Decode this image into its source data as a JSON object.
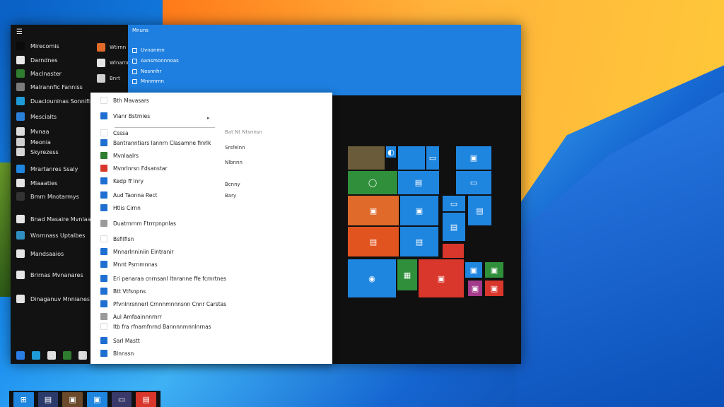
{
  "rail": {
    "top_icon": "hamburger-icon",
    "items": [
      {
        "label": "Mirecomis",
        "icon_color": "#0b0b0b"
      },
      {
        "label": "Darndnes",
        "icon_color": "#e9e9e9"
      },
      {
        "label": "Maclnaster",
        "icon_color": "#2f7d2f"
      },
      {
        "label": "Malrannfic Fanniss",
        "icon_color": "#7b7b7b"
      },
      {
        "label": "Duaciouninas Sonnifinas",
        "icon_color": "#1e9bd7"
      },
      {
        "label": "Mescialts",
        "icon_color": "#2a7fd9"
      },
      {
        "label": "Mvnaa",
        "icon_color": "#dcdcdc"
      },
      {
        "label": "Meonia",
        "icon_color": "#cfcfcf"
      },
      {
        "label": "Skyrezess",
        "icon_color": "#d5d5d5"
      },
      {
        "label": "Mrartanres Ssaly",
        "icon_color": "#1f86e0"
      },
      {
        "label": "Mlaaaties",
        "icon_color": "#e5e5e5"
      },
      {
        "label": "Bmrn Mnotarmys",
        "icon_color": "#333333"
      },
      {
        "label": "Bnad Masaire Mvnlaar Sermmtunns",
        "icon_color": "#e6e6e6"
      },
      {
        "label": "Wnrnnass Uptalbes",
        "icon_color": "#2f8fc0"
      },
      {
        "label": "Mandsaaios",
        "icon_color": "#e5e5e5"
      },
      {
        "label": "Brirnas Mvnanares",
        "icon_color": "#e5e5e5"
      },
      {
        "label": "Dinaganuv Mnnianes",
        "icon_color": "#e5e5e5"
      }
    ],
    "bottom_icons": [
      {
        "name": "user-icon",
        "color": "#2b7de6"
      },
      {
        "name": "documents-icon",
        "color": "#1e9bd7"
      },
      {
        "name": "pictures-icon",
        "color": "#e0e0e0"
      },
      {
        "name": "settings-icon",
        "color": "#2f7d2f"
      },
      {
        "name": "power-icon",
        "color": "#e0e0e0"
      }
    ]
  },
  "mid": {
    "items": [
      {
        "label": "Wtirnn",
        "icon_color": "#e06a2a"
      },
      {
        "label": "Wlnarnn",
        "icon_color": "#e5e5e5"
      },
      {
        "label": "Bnrt",
        "icon_color": "#cfcfcf"
      }
    ]
  },
  "blue_panel": {
    "title": "Mnuns",
    "items": [
      "Uvnanmn",
      "Aansmonnnoas",
      "Nosnnhr",
      "Mnnmmn"
    ]
  },
  "popup": {
    "rows": [
      {
        "label": "Bth Mavasars",
        "icon_color": "#ffffff"
      },
      {
        "label": "Vianr Bstrnies",
        "icon_color": "#1e6fd1"
      },
      {
        "label": "Csssa",
        "icon_color": "#ffffff"
      },
      {
        "label": "Bantranntiars lannrn Clasamne finrlk",
        "icon_color": "#1e6fd1"
      },
      {
        "label": "Mvnlaalrs",
        "icon_color": "#2f7d2f"
      },
      {
        "label": "Mvnrlnrsn Fdsanstar",
        "icon_color": "#d9362c"
      },
      {
        "label": "Kedp ff lnry",
        "icon_color": "#1e6fd1"
      },
      {
        "label": "Aud Taonna Rect",
        "icon_color": "#1e6fd1"
      },
      {
        "label": "Htlis Cirnn",
        "icon_color": "#1e6fd1"
      },
      {
        "label": "Duatrnrnm Ftrrrpnpnlas",
        "icon_color": "#9a9a9a"
      },
      {
        "label": "Bsfilfisn",
        "icon_color": "#ffffff"
      },
      {
        "label": "Mnnarlnniniin Eintranir",
        "icon_color": "#1e6fd1"
      },
      {
        "label": "Mnnt Psrnmnnas",
        "icon_color": "#1e6fd1"
      },
      {
        "label": "Eri penaraa cnrnsanl Itnranne ffe fcrnrtnes",
        "icon_color": "#1e6fd1"
      },
      {
        "label": "Btt Vtfsnpns",
        "icon_color": "#1e6fd1"
      },
      {
        "label": "Pfvnlnrsnnerl Crnnnmnnnsnn Cnnr Carstas",
        "icon_color": "#1e6fd1"
      },
      {
        "label": "Aul Amfaainnnrnrr",
        "icon_color": "#9a9a9a"
      },
      {
        "label": "Itb fra rfnarnfnrnd Bannnnmnnlnrnas",
        "icon_color": "#ffffff"
      },
      {
        "label": "Sarl Mastt",
        "icon_color": "#1e6fd1"
      },
      {
        "label": "Blnnssn",
        "icon_color": "#1e6fd1"
      }
    ],
    "right_labels": [
      {
        "text": "Bat Nt Ntsnnsn",
        "muted": true
      },
      {
        "text": "Srsfelnn",
        "muted": false
      },
      {
        "text": "Nlbnnn",
        "muted": false
      },
      {
        "text": "Bcnny",
        "muted": false
      },
      {
        "text": "Bary",
        "muted": false
      }
    ],
    "caret": "▸"
  },
  "tiles": [
    {
      "name": "photo-tile",
      "color": "#6a5b3a",
      "glyph": ""
    },
    {
      "name": "edge-tile",
      "color": "#1f86e0",
      "glyph": "◐"
    },
    {
      "name": "office-tile",
      "color": "#1f86e0",
      "glyph": ""
    },
    {
      "name": "mail-tile",
      "color": "#1f86e0",
      "glyph": "▭"
    },
    {
      "name": "store-tile",
      "color": "#1f86e0",
      "glyph": "▣"
    },
    {
      "name": "news-tile",
      "color": "#1f86e0",
      "glyph": "▤"
    },
    {
      "name": "maps-tile",
      "color": "#2f8f3a",
      "glyph": "◯"
    },
    {
      "name": "weather-tile",
      "color": "#1f86e0",
      "glyph": "▭"
    },
    {
      "name": "photos-tile",
      "color": "#e06a2a",
      "glyph": "▣"
    },
    {
      "name": "people-tile",
      "color": "#1f86e0",
      "glyph": "▣"
    },
    {
      "name": "calendar-tile",
      "color": "#1f86e0",
      "glyph": "▭"
    },
    {
      "name": "money-tile",
      "color": "#1f86e0",
      "glyph": "▤"
    },
    {
      "name": "calculator-tile",
      "color": "#1f86e0",
      "glyph": "▤"
    },
    {
      "name": "powerpoint-tile",
      "color": "#e2541f",
      "glyph": "▤"
    },
    {
      "name": "word-tile",
      "color": "#1f86e0",
      "glyph": "▤"
    },
    {
      "name": "excel-tile",
      "color": "#2f8f3a",
      "glyph": "▦"
    },
    {
      "name": "skype-tile",
      "color": "#1f86e0",
      "glyph": "◉"
    },
    {
      "name": "flipboard-tile",
      "color": "#d9362c",
      "glyph": "▣"
    },
    {
      "name": "xbox-tile",
      "color": "#2f8f3a",
      "glyph": "▣"
    },
    {
      "name": "groove-tile",
      "color": "#a33a8a",
      "glyph": "▣"
    },
    {
      "name": "onenote-tile",
      "color": "#d9362c",
      "glyph": "▣"
    },
    {
      "name": "camera-tile",
      "color": "#1f86e0",
      "glyph": "▣"
    },
    {
      "name": "red-tile",
      "color": "#d9362c",
      "glyph": ""
    }
  ],
  "taskbar": [
    {
      "name": "start-button",
      "color": "#1f86e0",
      "glyph": "⊞"
    },
    {
      "name": "search-button",
      "color": "#2a3a6a",
      "glyph": "▤"
    },
    {
      "name": "photos-taskbar-icon",
      "color": "#6a4a2a",
      "glyph": "▣"
    },
    {
      "name": "store-taskbar-icon",
      "color": "#1f86e0",
      "glyph": "▣"
    },
    {
      "name": "mail-taskbar-icon",
      "color": "#3a3a6a",
      "glyph": "▭"
    },
    {
      "name": "office-taskbar-icon",
      "color": "#d9362c",
      "glyph": "▤"
    }
  ]
}
